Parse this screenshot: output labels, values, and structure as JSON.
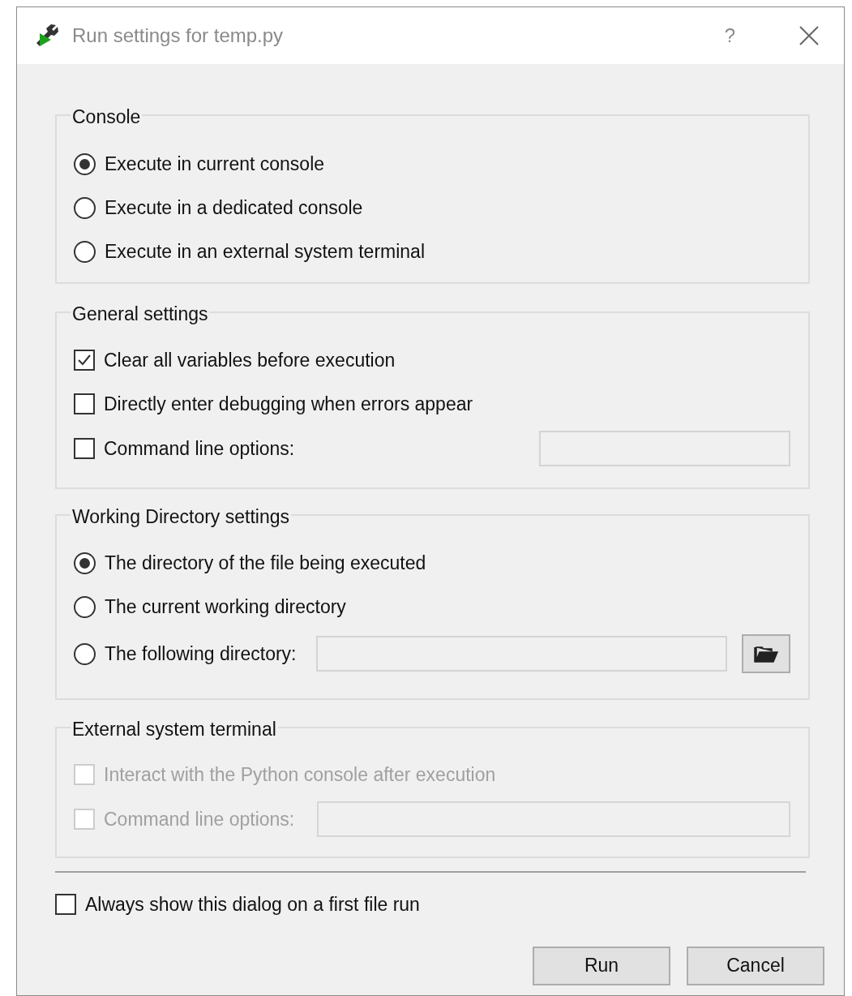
{
  "window": {
    "title": "Run settings for temp.py",
    "help": "?"
  },
  "groups": [
    {
      "title": "Console",
      "disabled": false,
      "items": [
        {
          "kind": "radio",
          "label": "Execute in current console",
          "selected": true
        },
        {
          "kind": "radio",
          "label": "Execute in a dedicated console",
          "selected": false
        },
        {
          "kind": "radio",
          "label": "Execute in an external system terminal",
          "selected": false
        }
      ]
    },
    {
      "title": "General settings",
      "disabled": false,
      "items": [
        {
          "kind": "check",
          "label": "Clear all variables before execution",
          "checked": true
        },
        {
          "kind": "check",
          "label": "Directly enter debugging when errors appear",
          "checked": false
        },
        {
          "kind": "check_field",
          "label": "Command line options:",
          "checked": false
        }
      ]
    },
    {
      "title": "Working Directory settings",
      "disabled": false,
      "items": [
        {
          "kind": "radio",
          "label": "The directory of the file being executed",
          "selected": true
        },
        {
          "kind": "radio",
          "label": "The current working directory",
          "selected": false
        },
        {
          "kind": "radio_browse",
          "label": "The following directory:",
          "selected": false
        }
      ]
    },
    {
      "title": "External system terminal",
      "disabled": true,
      "items": [
        {
          "kind": "check",
          "label": "Interact with the Python console after execution",
          "checked": false
        },
        {
          "kind": "check_field",
          "label": "Command line options:",
          "checked": false
        }
      ]
    }
  ],
  "always_show": {
    "label": "Always show this dialog on a first file run",
    "checked": false
  },
  "buttons": [
    "Run",
    "Cancel"
  ]
}
